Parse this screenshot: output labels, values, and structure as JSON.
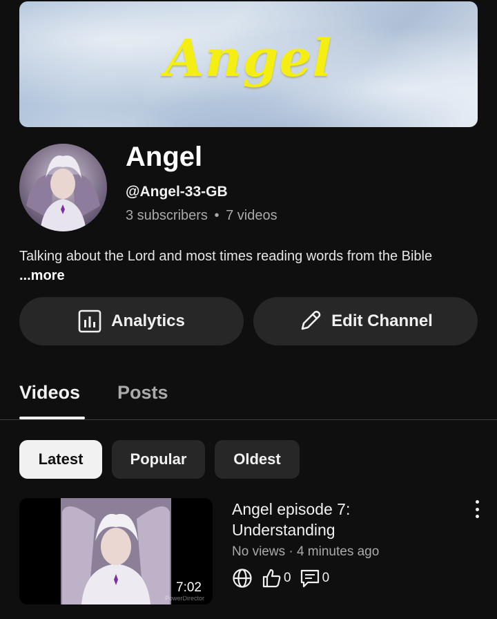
{
  "banner": {
    "title": "Angel"
  },
  "channel": {
    "name": "Angel",
    "handle": "@Angel-33-GB",
    "subscribers": "3 subscribers",
    "separator": "•",
    "videos": "7 videos",
    "description": "Talking about the Lord and most times reading words from the Bible",
    "more_label": "...more"
  },
  "actions": {
    "analytics_label": "Analytics",
    "edit_label": "Edit Channel"
  },
  "tabs": [
    {
      "label": "Videos"
    },
    {
      "label": "Posts"
    }
  ],
  "filters": [
    {
      "label": "Latest"
    },
    {
      "label": "Popular"
    },
    {
      "label": "Oldest"
    }
  ],
  "video": {
    "title": "Angel episode 7: Understanding",
    "meta": "No views · 4 minutes ago",
    "duration": "7:02",
    "watermark": "PowerDirector",
    "likes": "0",
    "comments": "0"
  },
  "icons": [
    "analytics-icon",
    "pencil-icon",
    "globe-icon",
    "thumbs-up-icon",
    "comment-icon",
    "more-vert-icon"
  ],
  "colors": {
    "background": "#0f0f0f",
    "banner_text": "#f5ee12",
    "chip_active": "#f1f1f1"
  }
}
